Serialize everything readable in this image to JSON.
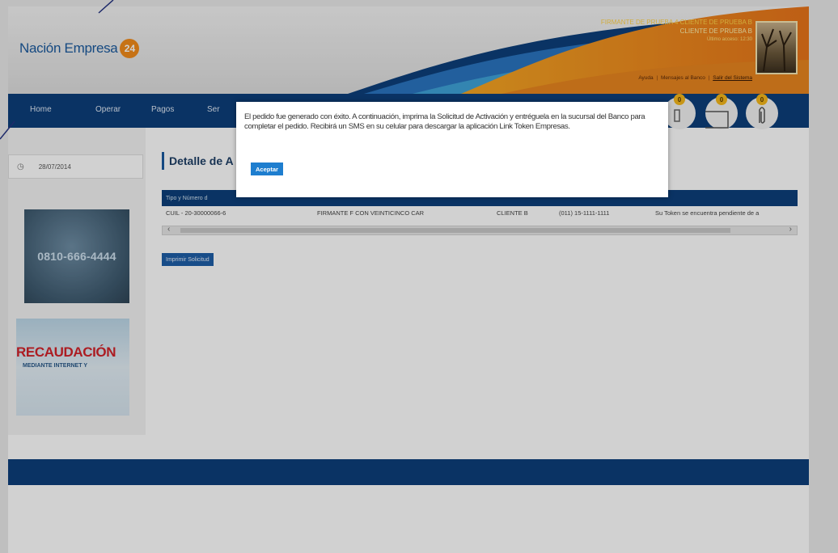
{
  "colors": {
    "navy": "#0d3f7a",
    "brand_blue": "#1a5a9e",
    "orange": "#f28c1c",
    "accent_red": "#d2232a",
    "button_blue": "#1e7ecf"
  },
  "header": {
    "logo_text": "Nación Empresa",
    "logo_badge": "24",
    "user_line1": "FIRMANTE DE PRUEBA 4 CLIENTE DE PRUEBA B",
    "user_line2": "CLIENTE DE PRUEBA B",
    "user_line3": "Último acceso: 12:30",
    "links": {
      "ayuda": "Ayuda",
      "sep1": "|",
      "mensajes": "Mensajes al Banco",
      "sep2": "|",
      "salir": "Salir del Sistema"
    },
    "avatar_icon": "user-photo"
  },
  "nav": {
    "items": [
      "Home",
      "Operar",
      "Pagos",
      "Ser"
    ],
    "badges": [
      {
        "icon": "alert-icon",
        "count": "0"
      },
      {
        "icon": "folder-icon",
        "count": "0"
      },
      {
        "icon": "paperclip-icon",
        "count": "0"
      }
    ]
  },
  "sidebar": {
    "date": "28/07/2014",
    "clock_icon": "clock-icon",
    "phone": "0810-666-4444",
    "recaud_title": "RECAUDACIÓN",
    "recaud_sub": "MEDIANTE INTERNET Y"
  },
  "content": {
    "title": "Detalle de A",
    "table": {
      "header": "Tipo y Número d",
      "row": [
        "CUIL - 20-30000066-6",
        "FIRMANTE F CON VEINTICINCO CAR",
        "CLIENTE B",
        "(011) 15-1111-1111",
        "Su Token se encuentra pendiente de a"
      ]
    },
    "print_button": "Imprimir Solicitud"
  },
  "modal": {
    "message": "El pedido fue generado con éxito. A continuación, imprima la Solicitud de Activación y entréguela en la sucursal del Banco para completar el pedido. Recibirá un SMS en su celular para descargar la aplicación Link Token Empresas.",
    "accept_button": "Aceptar"
  }
}
